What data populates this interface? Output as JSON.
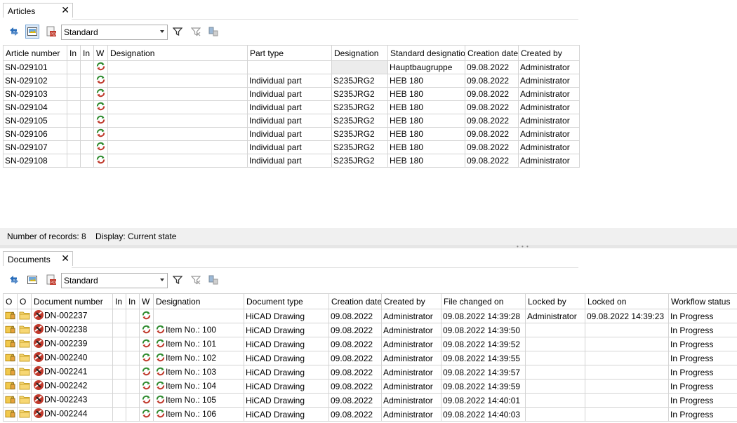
{
  "articles": {
    "tab_title": "Articles",
    "view_value": "Standard",
    "columns": [
      "Article number",
      "In",
      "In",
      "W",
      "Designation",
      "Part type",
      "Designation",
      "Standard designatio",
      "Creation date",
      "Created by"
    ],
    "rows": [
      [
        "SN-029101",
        "",
        "",
        "",
        "",
        "",
        "",
        "Hauptbaugruppe",
        "09.08.2022",
        "Administrator"
      ],
      [
        "SN-029102",
        "",
        "",
        "",
        "",
        "Individual part",
        "S235JRG2",
        "HEB 180",
        "09.08.2022",
        "Administrator"
      ],
      [
        "SN-029103",
        "",
        "",
        "",
        "",
        "Individual part",
        "S235JRG2",
        "HEB 180",
        "09.08.2022",
        "Administrator"
      ],
      [
        "SN-029104",
        "",
        "",
        "",
        "",
        "Individual part",
        "S235JRG2",
        "HEB 180",
        "09.08.2022",
        "Administrator"
      ],
      [
        "SN-029105",
        "",
        "",
        "",
        "",
        "Individual part",
        "S235JRG2",
        "HEB 180",
        "09.08.2022",
        "Administrator"
      ],
      [
        "SN-029106",
        "",
        "",
        "",
        "",
        "Individual part",
        "S235JRG2",
        "HEB 180",
        "09.08.2022",
        "Administrator"
      ],
      [
        "SN-029107",
        "",
        "",
        "",
        "",
        "Individual part",
        "S235JRG2",
        "HEB 180",
        "09.08.2022",
        "Administrator"
      ],
      [
        "SN-029108",
        "",
        "",
        "",
        "",
        "Individual part",
        "S235JRG2",
        "HEB 180",
        "09.08.2022",
        "Administrator"
      ]
    ],
    "status_records": "Number of records: 8",
    "status_display": "Display: Current state"
  },
  "documents": {
    "tab_title": "Documents",
    "view_value": "Standard",
    "columns": [
      "O",
      "O",
      "Document number",
      "In",
      "In",
      "W",
      "Designation",
      "Document type",
      "Creation date",
      "Created by",
      "File changed on",
      "Locked by",
      "Locked on",
      "Workflow status"
    ],
    "rows": [
      [
        "DN-002237",
        "",
        "HiCAD Drawing",
        "09.08.2022",
        "Administrator",
        "09.08.2022 14:39:28",
        "Administrator",
        "09.08.2022 14:39:23",
        "In Progress"
      ],
      [
        "DN-002238",
        "Item No.: 100",
        "HiCAD Drawing",
        "09.08.2022",
        "Administrator",
        "09.08.2022 14:39:50",
        "",
        "",
        "In Progress"
      ],
      [
        "DN-002239",
        "Item No.: 101",
        "HiCAD Drawing",
        "09.08.2022",
        "Administrator",
        "09.08.2022 14:39:52",
        "",
        "",
        "In Progress"
      ],
      [
        "DN-002240",
        "Item No.: 102",
        "HiCAD Drawing",
        "09.08.2022",
        "Administrator",
        "09.08.2022 14:39:55",
        "",
        "",
        "In Progress"
      ],
      [
        "DN-002241",
        "Item No.: 103",
        "HiCAD Drawing",
        "09.08.2022",
        "Administrator",
        "09.08.2022 14:39:57",
        "",
        "",
        "In Progress"
      ],
      [
        "DN-002242",
        "Item No.: 104",
        "HiCAD Drawing",
        "09.08.2022",
        "Administrator",
        "09.08.2022 14:39:59",
        "",
        "",
        "In Progress"
      ],
      [
        "DN-002243",
        "Item No.: 105",
        "HiCAD Drawing",
        "09.08.2022",
        "Administrator",
        "09.08.2022 14:40:01",
        "",
        "",
        "In Progress"
      ],
      [
        "DN-002244",
        "Item No.: 106",
        "HiCAD Drawing",
        "09.08.2022",
        "Administrator",
        "09.08.2022 14:40:03",
        "",
        "",
        "In Progress"
      ]
    ]
  },
  "icons": {
    "refresh": "refresh-icon",
    "preview": "preview-icon",
    "pdf": "pdf-icon",
    "filter": "filter-icon",
    "clear_filter": "clear-filter-icon",
    "columns": "column-settings-icon",
    "workflow": "workflow-icon",
    "lock": "lock-icon",
    "folder": "folder-icon",
    "hicad": "hicad-icon"
  }
}
